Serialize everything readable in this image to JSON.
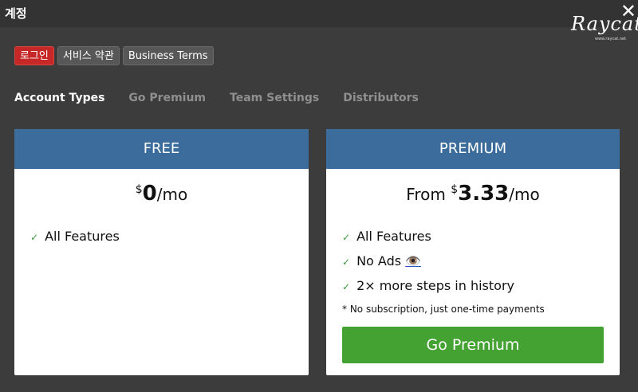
{
  "window": {
    "title": "계정"
  },
  "logo": {
    "text": "Raycat",
    "sub": "www.raycat.net"
  },
  "top_buttons": [
    {
      "label": "로그인"
    },
    {
      "label": "서비스 약관"
    },
    {
      "label": "Business Terms"
    }
  ],
  "tabs": [
    {
      "label": "Account Types"
    },
    {
      "label": "Go Premium"
    },
    {
      "label": "Team Settings"
    },
    {
      "label": "Distributors"
    }
  ],
  "free": {
    "header": "FREE",
    "price_dollar": "$",
    "price_amount": "0",
    "price_unit": "/mo",
    "features": [
      "All Features"
    ]
  },
  "premium": {
    "header": "PREMIUM",
    "price_prefix": "From ",
    "price_dollar": "$",
    "price_amount": "3.33",
    "price_unit": "/mo",
    "features": [
      "All Features",
      "No Ads",
      "2× more steps in history"
    ],
    "no_ads_icon": "👁️",
    "note": "* No subscription, just one-time payments",
    "cta": "Go Premium"
  },
  "check_glyph": "✓",
  "colors": {
    "active_button": "#c62828",
    "card_header": "#3b6c9c",
    "cta_green": "#43a231",
    "check_green": "#3a9a3a"
  }
}
